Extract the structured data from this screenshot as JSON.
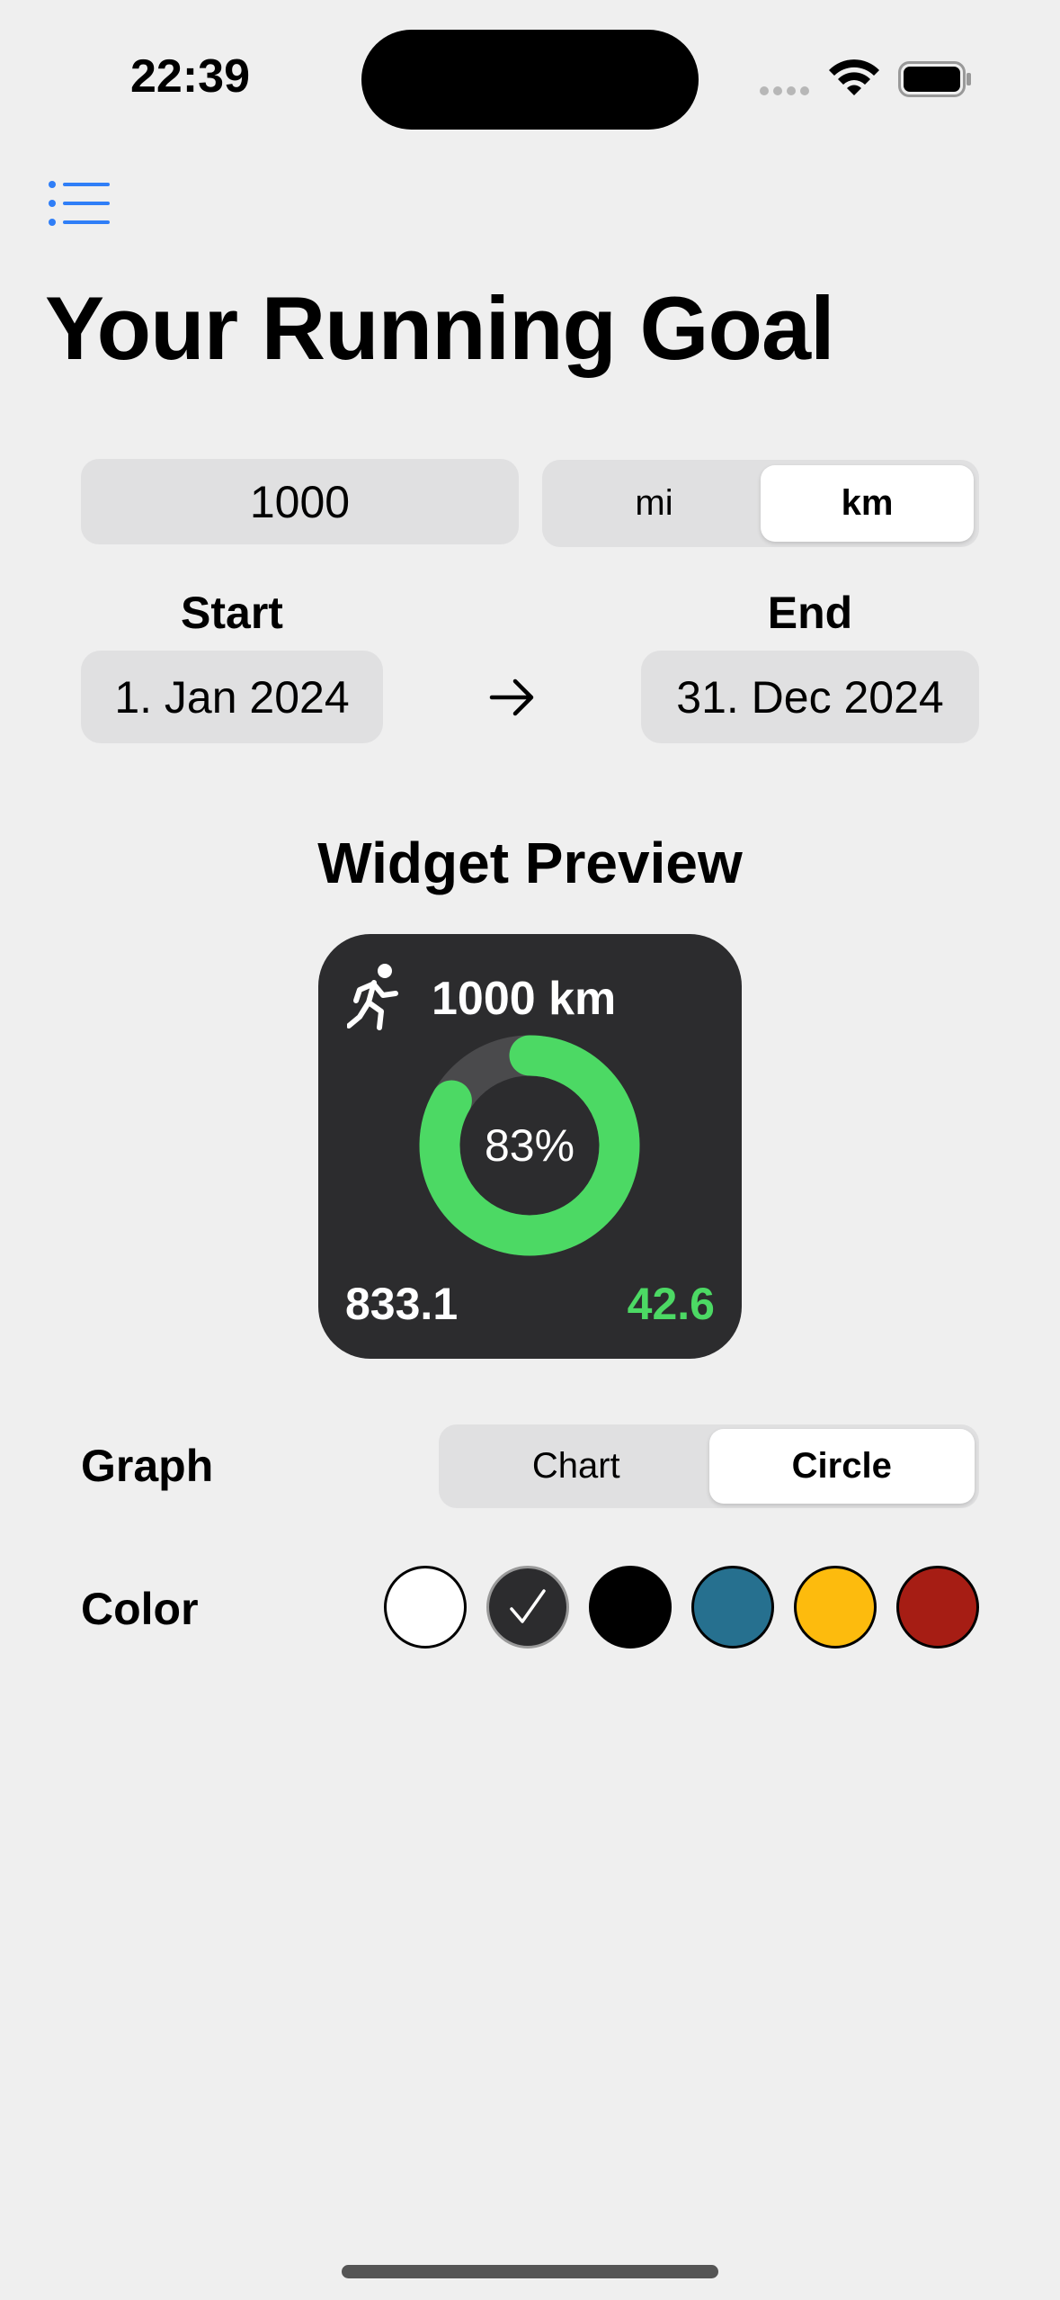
{
  "status_bar": {
    "time": "22:39"
  },
  "title": "Your Running Goal",
  "goal": {
    "value": "1000",
    "units": [
      "mi",
      "km"
    ],
    "selected_unit": "km"
  },
  "dates": {
    "start_label": "Start",
    "start_value": "1. Jan 2024",
    "end_label": "End",
    "end_value": "31. Dec 2024"
  },
  "widget_preview": {
    "section_title": "Widget Preview",
    "goal_text": "1000 km",
    "percent_text": "83%",
    "progress_fraction": 0.833,
    "done": "833.1",
    "remaining": "42.6",
    "colors": {
      "background": "#2c2c2e",
      "ring": "#4cd964",
      "track": "#4a4a4c"
    }
  },
  "graph": {
    "label": "Graph",
    "options": [
      "Chart",
      "Circle"
    ],
    "selected": "Circle"
  },
  "color": {
    "label": "Color",
    "swatches": [
      "#ffffff",
      "#2c2c2e",
      "#000000",
      "#26708f",
      "#fdbb0d",
      "#a61d14"
    ],
    "selected_index": 1
  },
  "icons": {
    "menu": "list-icon",
    "arrow": "arrow-right-icon",
    "runner": "figure-run-icon",
    "check": "checkmark-icon"
  }
}
